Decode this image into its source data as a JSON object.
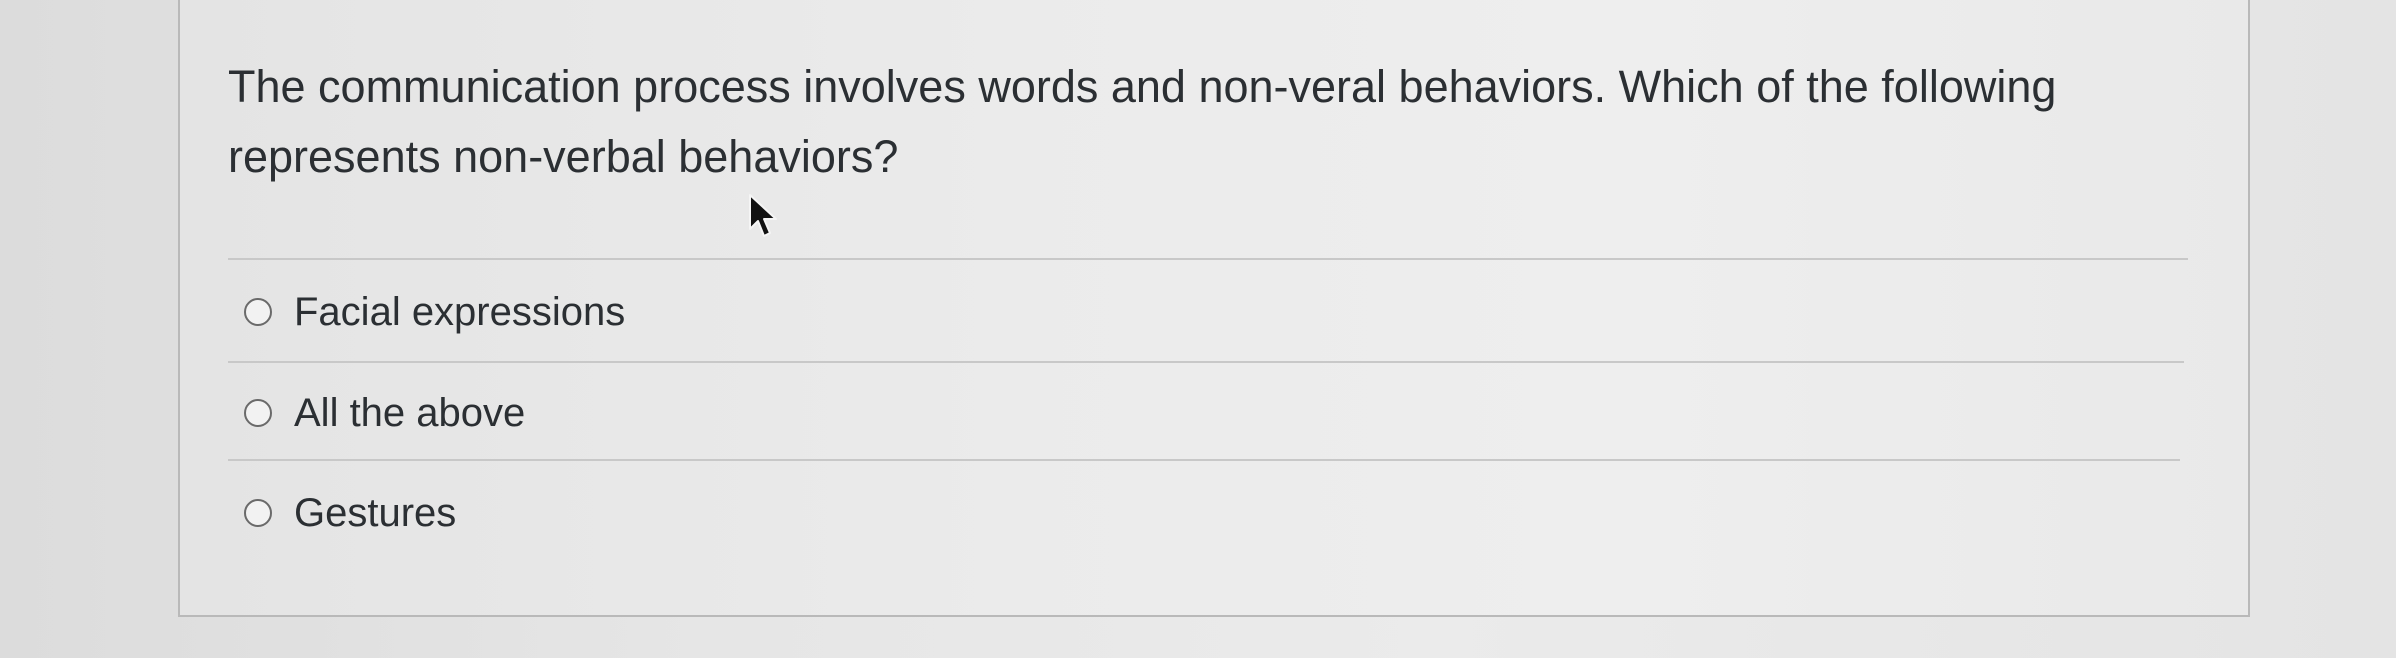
{
  "question": {
    "text": "The communication process involves words and non-veral behaviors.  Which of the following represents non-verbal behaviors?"
  },
  "answers": [
    {
      "label": "Facial expressions",
      "selected": false
    },
    {
      "label": "All the above",
      "selected": false
    },
    {
      "label": "Gestures",
      "selected": false
    }
  ],
  "icons": {
    "pointer": "mouse-pointer-icon",
    "radio": "radio-button-icon"
  }
}
